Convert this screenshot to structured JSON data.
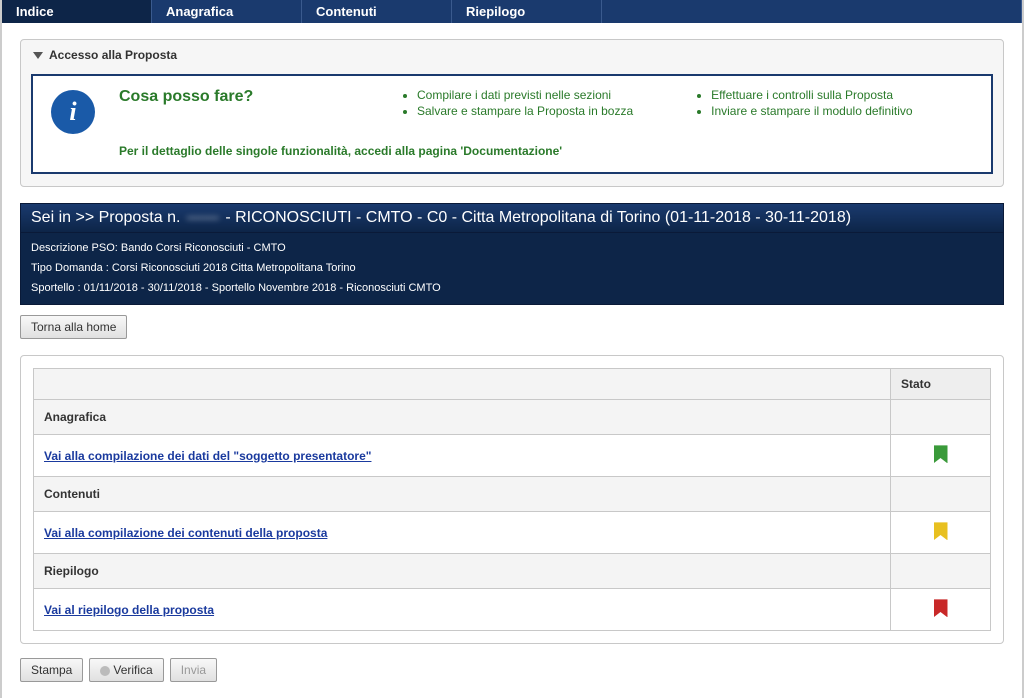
{
  "tabs": [
    {
      "label": "Indice",
      "active": true
    },
    {
      "label": "Anagrafica",
      "active": false
    },
    {
      "label": "Contenuti",
      "active": false
    },
    {
      "label": "Riepilogo",
      "active": false
    }
  ],
  "access_panel": {
    "title": "Accesso alla Proposta"
  },
  "help": {
    "title": "Cosa posso fare?",
    "list1": [
      "Compilare i dati previsti nelle sezioni",
      "Salvare e stampare la Proposta in bozza"
    ],
    "list2": [
      "Effettuare i controlli sulla Proposta",
      "Inviare e stampare il modulo definitivo"
    ],
    "footer": "Per il dettaglio delle singole funzionalità, accedi alla pagina 'Documentazione'"
  },
  "breadcrumb": {
    "prefix": "Sei in >> Proposta n.",
    "num": "——",
    "rest": "- RICONOSCIUTI - CMTO - C0 - Citta Metropolitana di Torino (01-11-2018 - 30-11-2018)"
  },
  "meta": {
    "line1": "Descrizione PSO: Bando Corsi Riconosciuti - CMTO",
    "line2": "Tipo Domanda : Corsi Riconosciuti 2018 Citta Metropolitana Torino",
    "line3": "Sportello : 01/11/2018 - 30/11/2018 - Sportello Novembre 2018 - Riconosciuti CMTO"
  },
  "buttons": {
    "home": "Torna alla home",
    "stampa": "Stampa",
    "verifica": "Verifica",
    "invia": "Invia"
  },
  "table": {
    "header_empty": "",
    "header_stato": "Stato",
    "sections": [
      {
        "title": "Anagrafica",
        "link": "Vai alla compilazione dei dati del \"soggetto presentatore\"",
        "flag": "green"
      },
      {
        "title": "Contenuti",
        "link": "Vai alla compilazione dei contenuti della proposta",
        "flag": "yellow"
      },
      {
        "title": "Riepilogo",
        "link": "Vai al riepilogo della proposta",
        "flag": "red"
      }
    ]
  }
}
